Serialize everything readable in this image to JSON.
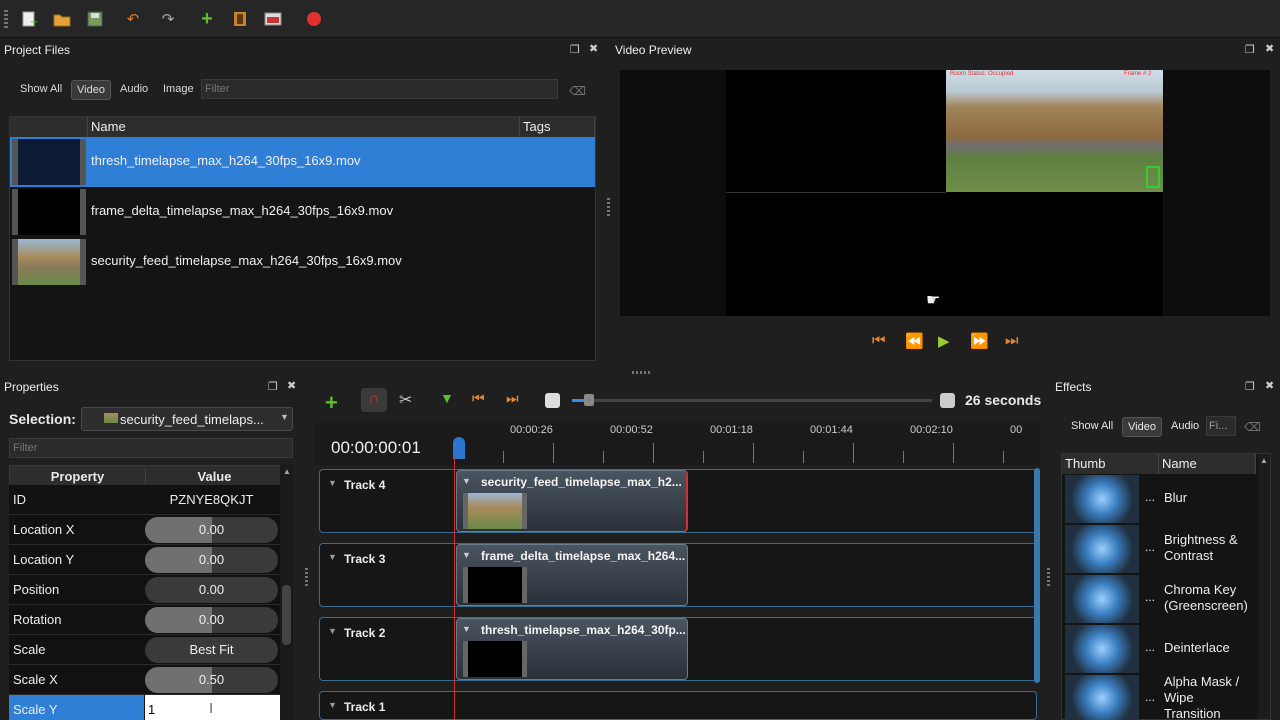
{
  "toolbar": {
    "icons": [
      "new-project-icon",
      "open-project-icon",
      "save-project-icon",
      "undo-icon",
      "redo-icon",
      "import-files-icon",
      "choose-profile-icon",
      "fullscreen-icon",
      "export-video-icon"
    ],
    "colors": {
      "add": "#5fbf2a",
      "record": "#e03030",
      "undo": "#e07a2a"
    }
  },
  "project_files": {
    "title": "Project Files",
    "tabs": [
      "Show All",
      "Video",
      "Audio",
      "Image"
    ],
    "active_tab": "Video",
    "filter_placeholder": "Filter",
    "columns": [
      "Name",
      "Tags"
    ],
    "rows": [
      {
        "name": "thresh_timelapse_max_h264_30fps_16x9.mov",
        "selected": true
      },
      {
        "name": "frame_delta_timelapse_max_h264_30fps_16x9.mov",
        "selected": false
      },
      {
        "name": "security_feed_timelapse_max_h264_30fps_16x9.mov",
        "selected": false
      }
    ]
  },
  "video_preview": {
    "title": "Video Preview",
    "overlay_status": "Room Status: Occupied",
    "overlay_frame": "Frame # 2"
  },
  "properties": {
    "title": "Properties",
    "selection_label": "Selection:",
    "selection_value": "security_feed_timelaps...",
    "filter_placeholder": "Filter",
    "columns": [
      "Property",
      "Value"
    ],
    "rows": [
      {
        "label": "ID",
        "value": "PZNYE8QKJT",
        "fill": null
      },
      {
        "label": "Location X",
        "value": "0.00",
        "fill": 0.5
      },
      {
        "label": "Location Y",
        "value": "0.00",
        "fill": 0.5
      },
      {
        "label": "Position",
        "value": "0.00",
        "fill": 0
      },
      {
        "label": "Rotation",
        "value": "0.00",
        "fill": 0.5
      },
      {
        "label": "Scale",
        "value": "Best Fit",
        "fill": 0
      },
      {
        "label": "Scale X",
        "value": "0.50",
        "fill": 0.5
      },
      {
        "label": "Scale Y",
        "value": "1",
        "fill": null,
        "editing": true
      }
    ]
  },
  "timeline": {
    "zoom_label": "26 seconds",
    "current_time": "00:00:00:01",
    "ruler_labels": [
      "00:00:26",
      "00:00:52",
      "00:01:18",
      "00:01:44",
      "00:02:10",
      "00"
    ],
    "tracks": [
      {
        "name": "Track 4",
        "clip": "security_feed_timelapse_max_h2..."
      },
      {
        "name": "Track 3",
        "clip": "frame_delta_timelapse_max_h264..."
      },
      {
        "name": "Track 2",
        "clip": "thresh_timelapse_max_h264_30fp..."
      },
      {
        "name": "Track 1",
        "clip": ""
      }
    ]
  },
  "effects": {
    "title": "Effects",
    "tabs": [
      "Show All",
      "Video",
      "Audio",
      "Fi..."
    ],
    "active_tab": "Video",
    "columns": [
      "Thumb",
      "Name"
    ],
    "items": [
      {
        "name": "Blur",
        "dots": "..."
      },
      {
        "name": "Brightness &\nContrast",
        "dots": "..."
      },
      {
        "name": "Chroma Key\n(Greenscreen)",
        "dots": "..."
      },
      {
        "name": "Deinterlace",
        "dots": "..."
      },
      {
        "name": "Alpha Mask /\nWipe\nTransition",
        "dots": "..."
      }
    ]
  }
}
